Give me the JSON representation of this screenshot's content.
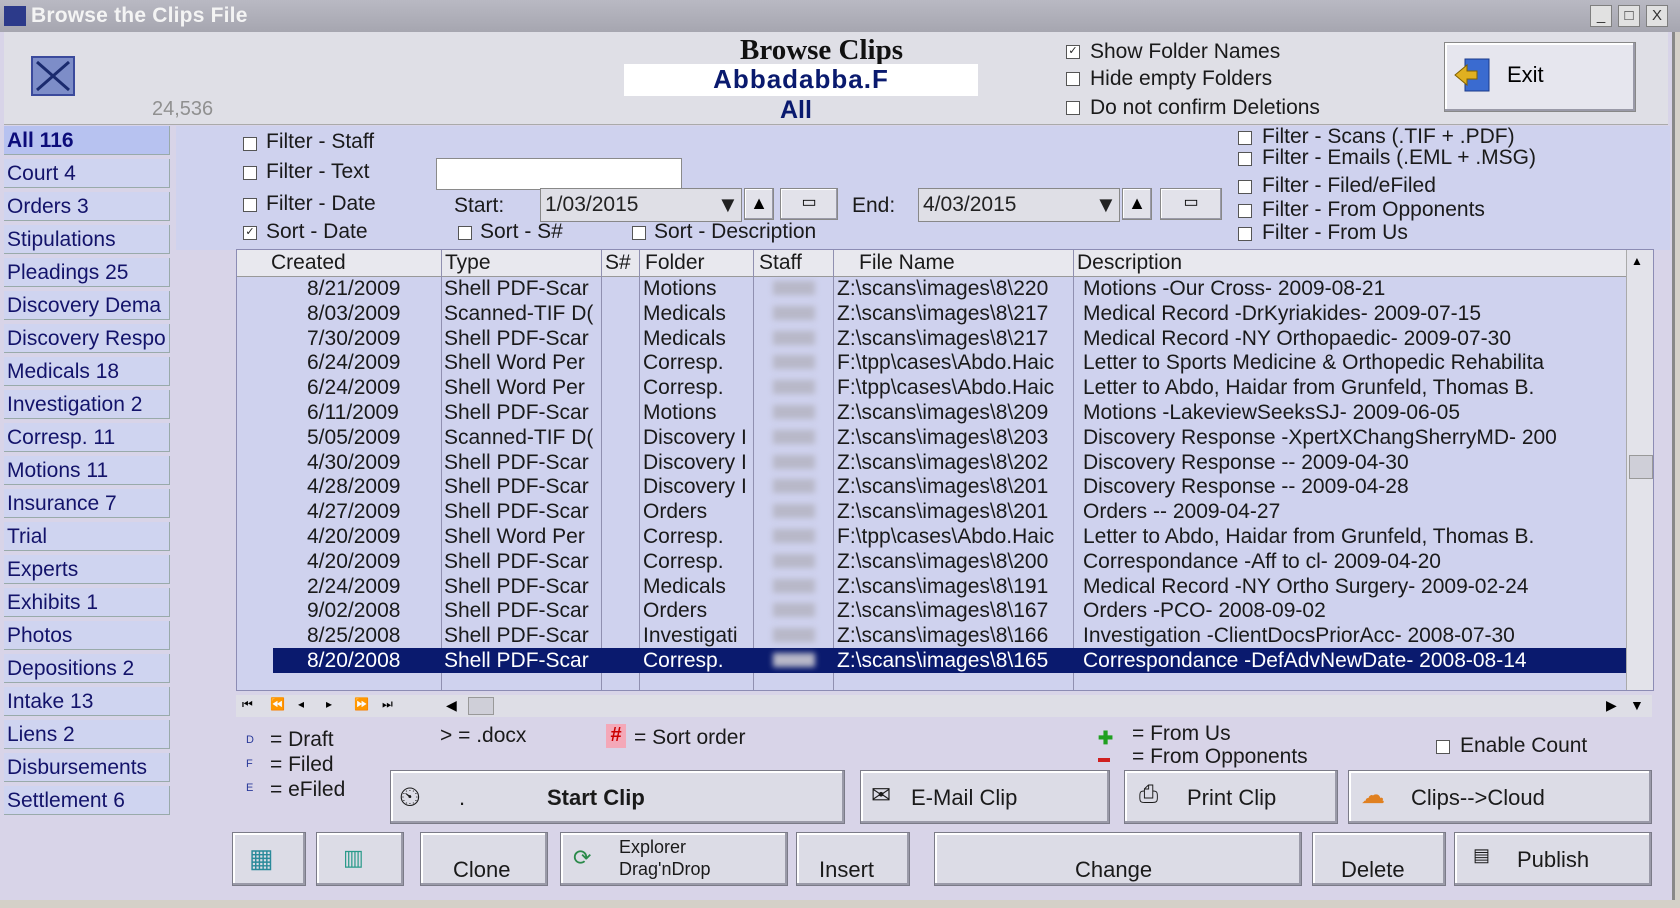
{
  "window": {
    "title": "Browse the Clips File",
    "controls": [
      "_",
      "□",
      "X"
    ]
  },
  "header": {
    "title": "Browse Clips",
    "case_name": "Abbadabba.F",
    "scope": "All",
    "count": "24,536",
    "options": [
      {
        "label": "Show Folder Names",
        "checked": true
      },
      {
        "label": "Hide empty Folders",
        "checked": false
      },
      {
        "label": "Do not confirm Deletions",
        "checked": false
      }
    ],
    "exit_label": "Exit"
  },
  "sidebar": {
    "items": [
      {
        "label": "All 116",
        "active": true
      },
      {
        "label": "Court 4"
      },
      {
        "label": "Orders 3"
      },
      {
        "label": "Stipulations"
      },
      {
        "label": "Pleadings 25"
      },
      {
        "label": "Discovery Dema"
      },
      {
        "label": "Discovery Respo"
      },
      {
        "label": "Medicals 18"
      },
      {
        "label": "Investigation 2"
      },
      {
        "label": "Corresp. 11"
      },
      {
        "label": "Motions 11"
      },
      {
        "label": "Insurance 7"
      },
      {
        "label": "Trial"
      },
      {
        "label": "Experts"
      },
      {
        "label": "Exhibits 1"
      },
      {
        "label": "Photos"
      },
      {
        "label": "Depositions 2"
      },
      {
        "label": "Intake 13"
      },
      {
        "label": "Liens 2"
      },
      {
        "label": "Disbursements"
      },
      {
        "label": "Settlement 6"
      }
    ]
  },
  "filters": {
    "staff": {
      "label": "Filter - Staff",
      "checked": false
    },
    "text": {
      "label": "Filter - Text",
      "checked": false,
      "value": ""
    },
    "date": {
      "label": "Filter - Date",
      "checked": false
    },
    "sort_date": {
      "label": "Sort - Date",
      "checked": true
    },
    "sort_s": {
      "label": "Sort - S#",
      "checked": false
    },
    "sort_desc": {
      "label": "Sort - Description",
      "checked": false
    },
    "start_label": "Start:",
    "start_value": "1/03/2015",
    "end_label": "End:",
    "end_value": "4/03/2015",
    "right": [
      {
        "label": "Filter - Scans (.TIF + .PDF)"
      },
      {
        "label": "Filter - Emails (.EML + .MSG)"
      },
      {
        "label": "Filter - Filed/eFiled"
      },
      {
        "label": "Filter - From Opponents"
      },
      {
        "label": "Filter - From Us"
      }
    ]
  },
  "table": {
    "columns": [
      "Created",
      "Type",
      "S#",
      "Folder",
      "Staff",
      "File Name",
      "Description"
    ],
    "rows": [
      {
        "created": "8/21/2009",
        "type": "Shell PDF-Scar",
        "folder": "Motions",
        "file": "Z:\\scans\\images\\8\\220",
        "desc": "Motions -Our Cross- 2009-08-21"
      },
      {
        "created": "8/03/2009",
        "type": "Scanned-TIF D(",
        "folder": "Medicals",
        "file": "Z:\\scans\\images\\8\\217",
        "desc": "Medical Record -DrKyriakides- 2009-07-15"
      },
      {
        "created": "7/30/2009",
        "type": "Shell PDF-Scar",
        "folder": "Medicals",
        "file": "Z:\\scans\\images\\8\\217",
        "desc": "Medical Record -NY Orthopaedic- 2009-07-30"
      },
      {
        "created": "6/24/2009",
        "type": "Shell Word Per",
        "folder": "Corresp.",
        "file": "F:\\tpp\\cases\\Abdo.Haic",
        "desc": "Letter to Sports Medicine & Orthopedic Rehabilita"
      },
      {
        "created": "6/24/2009",
        "type": "Shell Word Per",
        "folder": "Corresp.",
        "file": "F:\\tpp\\cases\\Abdo.Haic",
        "desc": "Letter to Abdo, Haidar from Grunfeld, Thomas B."
      },
      {
        "created": "6/11/2009",
        "type": "Shell PDF-Scar",
        "folder": "Motions",
        "file": "Z:\\scans\\images\\8\\209",
        "desc": "Motions -LakeviewSeeksSJ- 2009-06-05"
      },
      {
        "created": "5/05/2009",
        "type": "Scanned-TIF D(",
        "folder": "Discovery I",
        "file": "Z:\\scans\\images\\8\\203",
        "desc": "Discovery Response -XpertXChangSherryMD- 200"
      },
      {
        "created": "4/30/2009",
        "type": "Shell PDF-Scar",
        "folder": "Discovery I",
        "file": "Z:\\scans\\images\\8\\202",
        "desc": "Discovery Response -- 2009-04-30"
      },
      {
        "created": "4/28/2009",
        "type": "Shell PDF-Scar",
        "folder": "Discovery I",
        "file": "Z:\\scans\\images\\8\\201",
        "desc": "Discovery Response -- 2009-04-28"
      },
      {
        "created": "4/27/2009",
        "type": "Shell PDF-Scar",
        "folder": "Orders",
        "file": "Z:\\scans\\images\\8\\201",
        "desc": "Orders -- 2009-04-27"
      },
      {
        "created": "4/20/2009",
        "type": "Shell Word Per",
        "folder": "Corresp.",
        "file": "F:\\tpp\\cases\\Abdo.Haic",
        "desc": "Letter to Abdo, Haidar from Grunfeld, Thomas B."
      },
      {
        "created": "4/20/2009",
        "type": "Shell PDF-Scar",
        "folder": "Corresp.",
        "file": "Z:\\scans\\images\\8\\200",
        "desc": "Correspondance -Aff to cl- 2009-04-20"
      },
      {
        "created": "2/24/2009",
        "type": "Shell PDF-Scar",
        "folder": "Medicals",
        "file": "Z:\\scans\\images\\8\\191",
        "desc": "Medical Record -NY Ortho Surgery- 2009-02-24"
      },
      {
        "created": "9/02/2008",
        "type": "Shell PDF-Scar",
        "folder": "Orders",
        "file": "Z:\\scans\\images\\8\\167",
        "desc": "Orders -PCO- 2008-09-02"
      },
      {
        "created": "8/25/2008",
        "type": "Shell PDF-Scar",
        "folder": "Investigati",
        "file": "Z:\\scans\\images\\8\\166",
        "desc": "Investigation -ClientDocsPriorAcc- 2008-07-30"
      },
      {
        "created": "8/20/2008",
        "type": "Shell PDF-Scar",
        "folder": "Corresp.",
        "file": "Z:\\scans\\images\\8\\165",
        "desc": "Correspondance -DefAdvNewDate- 2008-08-14",
        "selected": true
      }
    ]
  },
  "legend": {
    "draft_sym": "D",
    "draft": "= Draft",
    "filed_sym": "F",
    "filed": "= Filed",
    "efiled_sym": "E",
    "efiled": "= eFiled",
    "docx": "> = .docx",
    "sort_sym": "#",
    "sort": "= Sort order",
    "from_us": "= From Us",
    "from_opp": "= From Opponents",
    "enable_count": "Enable Count"
  },
  "buttons": {
    "start_clip": "Start Clip",
    "start_clip_dot": ".",
    "email_clip": "E-Mail Clip",
    "print_clip": "Print Clip",
    "clips_cloud": "Clips-->Cloud",
    "clone": "Clone",
    "explorer_1": "Explorer",
    "explorer_2": "Drag'nDrop",
    "insert": "Insert",
    "change": "Change",
    "delete": "Delete",
    "publish": "Publish"
  },
  "colors": {
    "selection": "#0a1a6e",
    "panel": "#cfd2ee",
    "title_text": "#0a1a6e"
  }
}
